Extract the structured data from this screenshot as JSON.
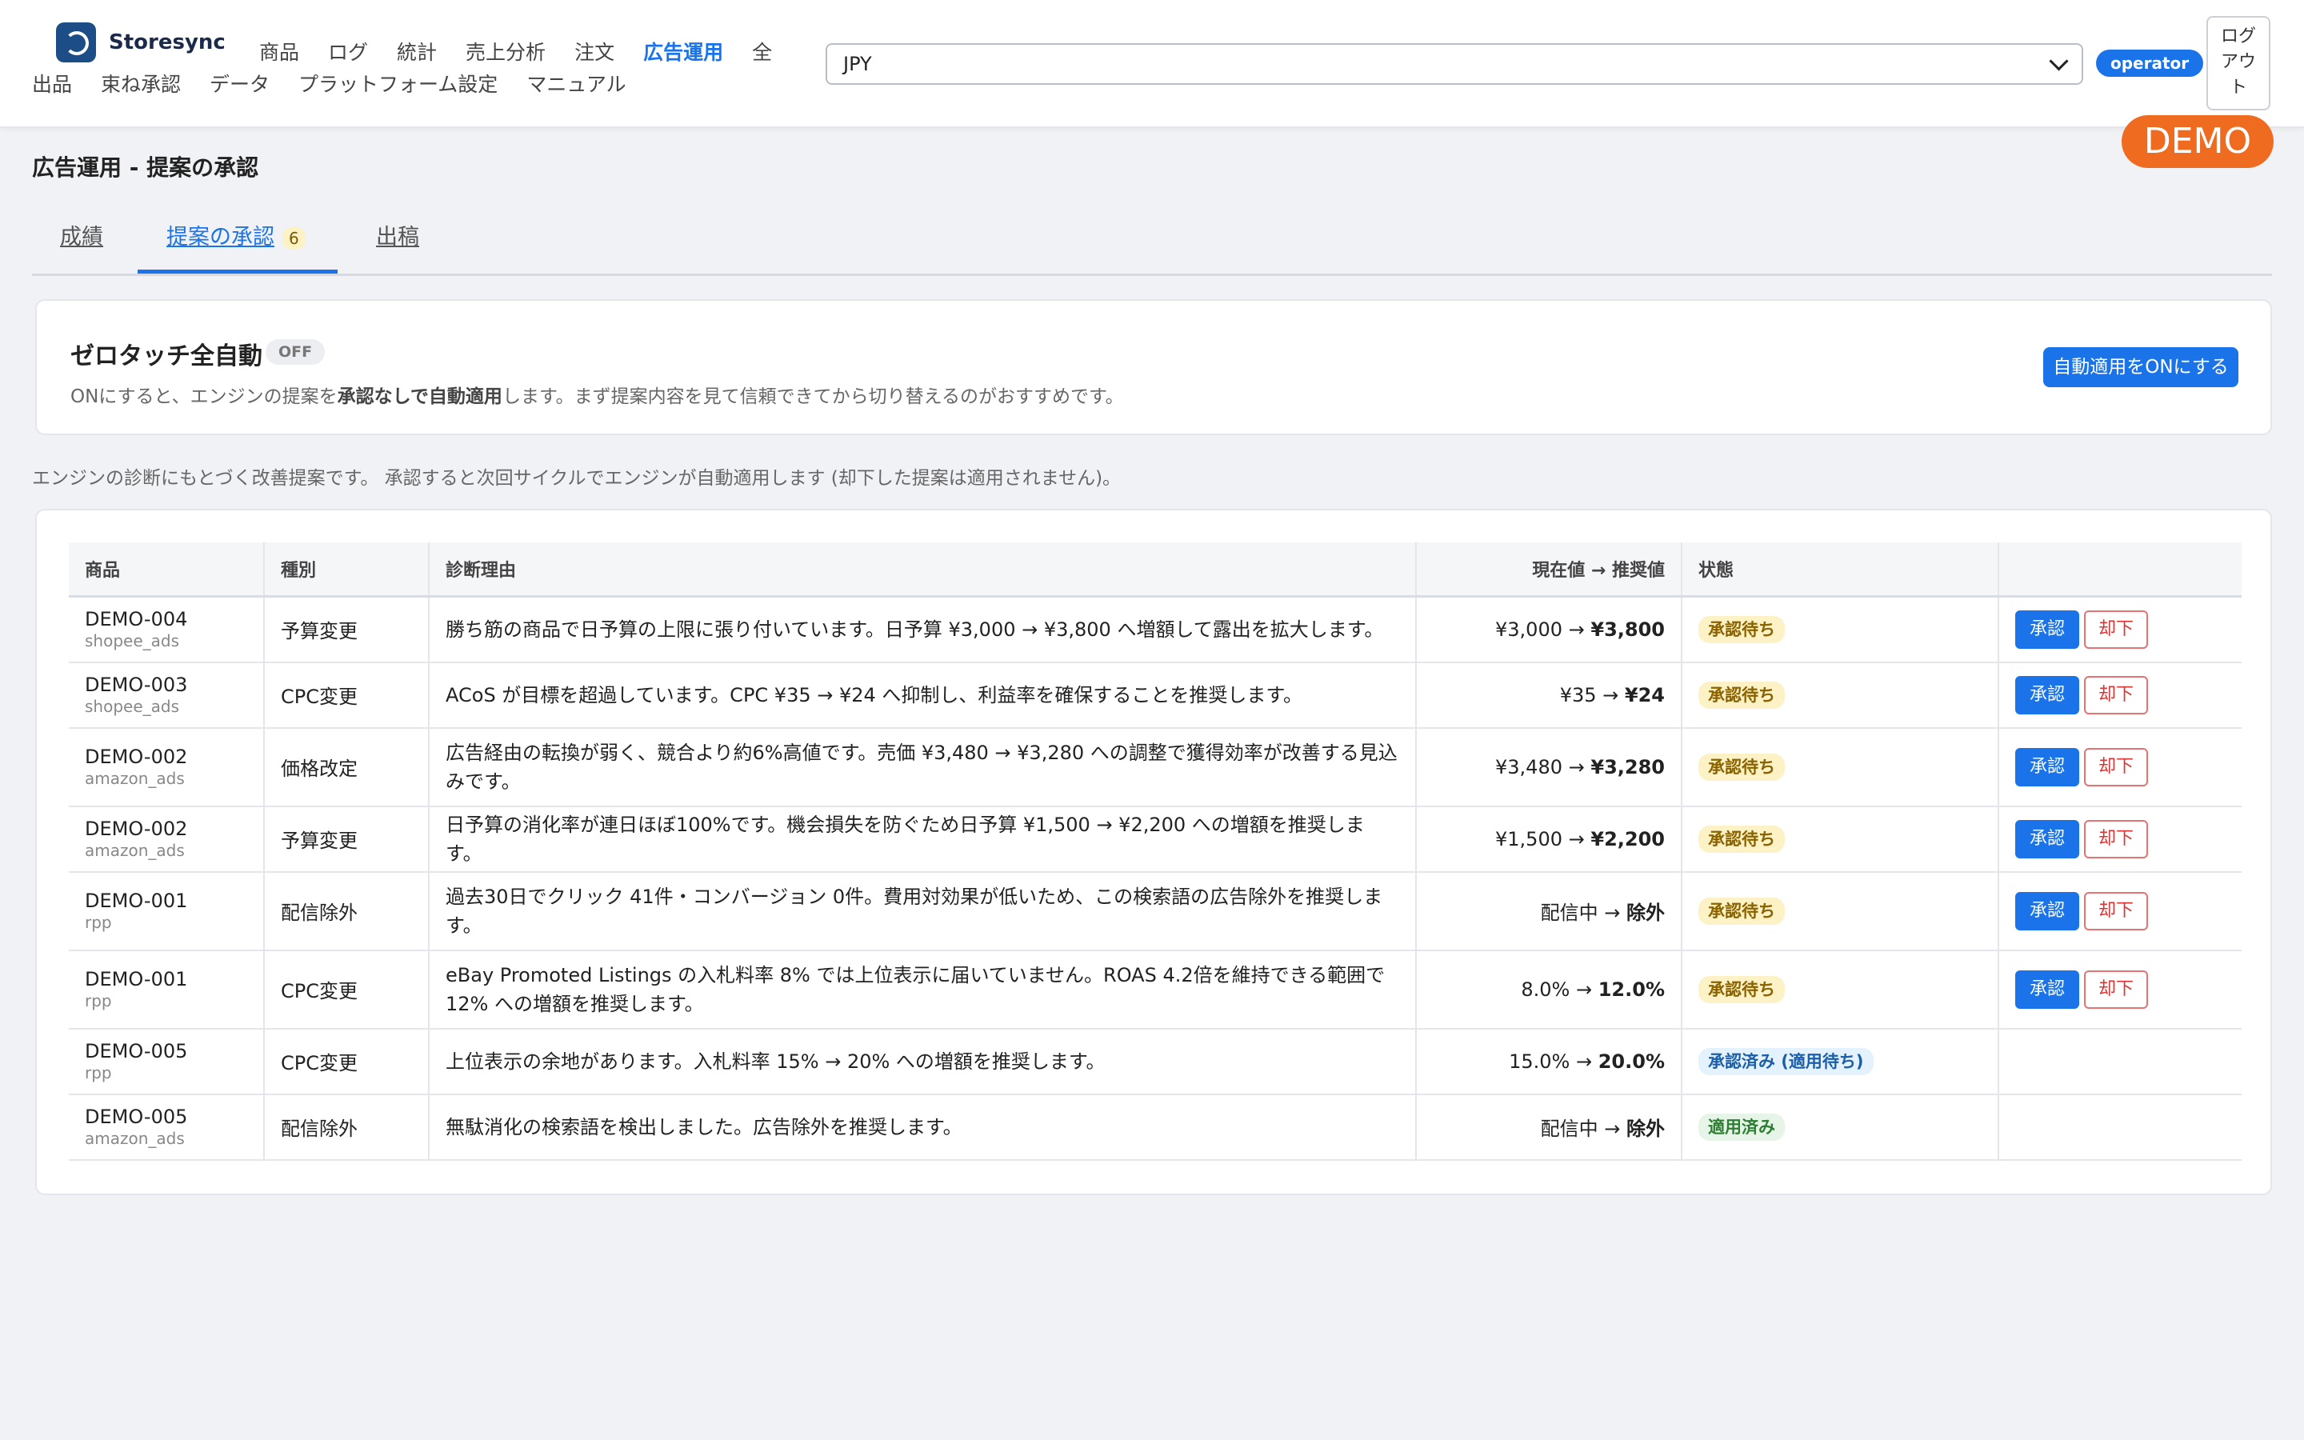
{
  "header": {
    "brand": "Storesync",
    "nav_row1": [
      "商品",
      "ログ",
      "統計",
      "売上分析",
      "注文",
      "広告運用",
      "全"
    ],
    "nav_row2": [
      "出品",
      "束ね承認",
      "データ",
      "プラットフォーム設定",
      "マニュアル"
    ],
    "active_nav": "広告運用",
    "currency_value": "JPY",
    "role": "operator",
    "logout_label": [
      "ログ",
      "アウ",
      "ト"
    ],
    "demo_badge": "DEMO"
  },
  "page": {
    "title": "広告運用 - 提案の承認",
    "tabs": [
      {
        "label": "成績"
      },
      {
        "label": "提案の承認",
        "count": "6"
      },
      {
        "label": "出稿"
      }
    ]
  },
  "zero_touch": {
    "title": "ゼロタッチ全自動",
    "status": "OFF",
    "desc_prefix": "ONにすると、エンジンの提案を",
    "desc_bold": "承認なしで自動適用",
    "desc_suffix": "します。まず提案内容を見て信頼できてから切り替えるのがおすすめです。",
    "button": "自動適用をONにする"
  },
  "note": "エンジンの診断にもとづく改善提案です。 承認すると次回サイクルでエンジンが自動適用します (却下した提案は適用されません)。",
  "table": {
    "headers": [
      "商品",
      "種別",
      "診断理由",
      "現在値 → 推奨値",
      "状態",
      ""
    ],
    "approve_label": "承認",
    "reject_label": "却下",
    "rows": [
      {
        "code": "DEMO-004",
        "source": "shopee_ads",
        "type": "予算変更",
        "reason": "勝ち筋の商品で日予算の上限に張り付いています。日予算 ¥3,000 → ¥3,800 へ増額して露出を拡大します。",
        "current": "¥3,000",
        "recommended": "¥3,800",
        "status": "承認待ち",
        "status_kind": "pending"
      },
      {
        "code": "DEMO-003",
        "source": "shopee_ads",
        "type": "CPC変更",
        "reason": "ACoS が目標を超過しています。CPC ¥35 → ¥24 へ抑制し、利益率を確保することを推奨します。",
        "current": "¥35",
        "recommended": "¥24",
        "status": "承認待ち",
        "status_kind": "pending"
      },
      {
        "code": "DEMO-002",
        "source": "amazon_ads",
        "type": "価格改定",
        "reason": "広告経由の転換が弱く、競合より約6%高値です。売価 ¥3,480 → ¥3,280 への調整で獲得効率が改善する見込みです。",
        "current": "¥3,480",
        "recommended": "¥3,280",
        "status": "承認待ち",
        "status_kind": "pending"
      },
      {
        "code": "DEMO-002",
        "source": "amazon_ads",
        "type": "予算変更",
        "reason": "日予算の消化率が連日ほぼ100%です。機会損失を防ぐため日予算 ¥1,500 → ¥2,200 への増額を推奨します。",
        "current": "¥1,500",
        "recommended": "¥2,200",
        "status": "承認待ち",
        "status_kind": "pending"
      },
      {
        "code": "DEMO-001",
        "source": "rpp",
        "type": "配信除外",
        "reason": "過去30日でクリック 41件・コンバージョン 0件。費用対効果が低いため、この検索語の広告除外を推奨します。",
        "current": "配信中",
        "recommended": "除外",
        "status": "承認待ち",
        "status_kind": "pending"
      },
      {
        "code": "DEMO-001",
        "source": "rpp",
        "type": "CPC変更",
        "reason": "eBay Promoted Listings の入札料率 8% では上位表示に届いていません。ROAS 4.2倍を維持できる範囲で 12% への増額を推奨します。",
        "current": "8.0%",
        "recommended": "12.0%",
        "status": "承認待ち",
        "status_kind": "pending"
      },
      {
        "code": "DEMO-005",
        "source": "rpp",
        "type": "CPC変更",
        "reason": "上位表示の余地があります。入札料率 15% → 20% への増額を推奨します。",
        "current": "15.0%",
        "recommended": "20.0%",
        "status": "承認済み (適用待ち)",
        "status_kind": "approved"
      },
      {
        "code": "DEMO-005",
        "source": "amazon_ads",
        "type": "配信除外",
        "reason": "無駄消化の検索語を検出しました。広告除外を推奨します。",
        "current": "配信中",
        "recommended": "除外",
        "status": "適用済み",
        "status_kind": "applied"
      }
    ]
  }
}
